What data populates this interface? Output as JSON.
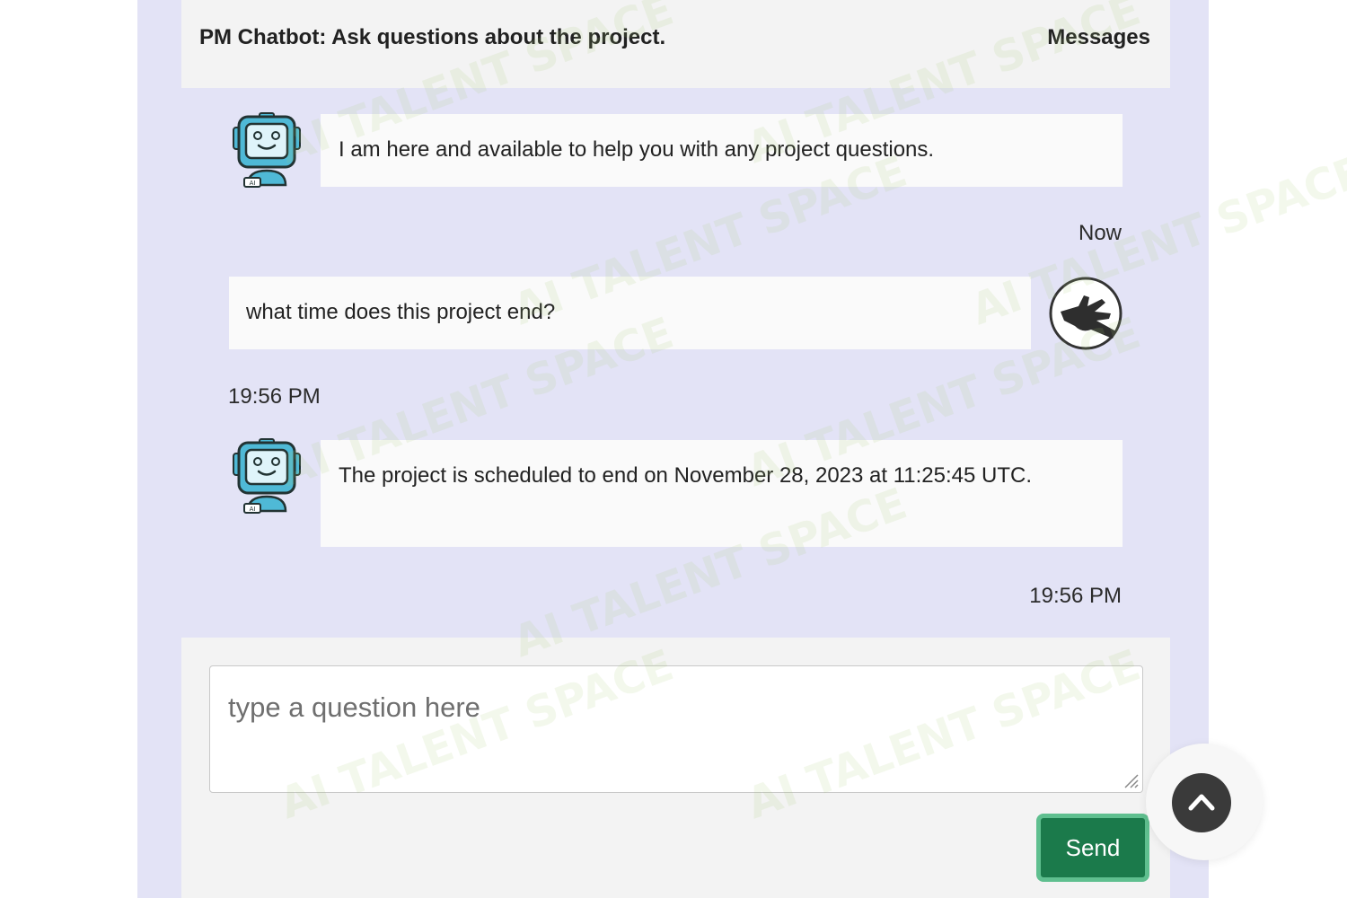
{
  "header": {
    "title": "PM Chatbot: Ask questions about the project.",
    "right_label": "Messages"
  },
  "messages": [
    {
      "sender": "bot",
      "text": "I am here and available to help you with any project questions.",
      "time": "Now"
    },
    {
      "sender": "user",
      "text": "what time does this project end?",
      "time": "19:56 PM"
    },
    {
      "sender": "bot",
      "text": "The project is scheduled to end on November 28, 2023 at 11:25:45 UTC.",
      "time": "19:56 PM"
    }
  ],
  "composer": {
    "placeholder": "type a question here",
    "send_label": "Send"
  },
  "icons": {
    "bot_avatar": "robot-ai-icon",
    "user_avatar": "hand-icon",
    "scroll_top": "chevron-up-icon"
  },
  "colors": {
    "messages_bg": "#e3e3f6",
    "send_button": "#1b7a4b",
    "send_border": "#5fbf8f"
  },
  "watermark": "AI TALENT SPACE"
}
